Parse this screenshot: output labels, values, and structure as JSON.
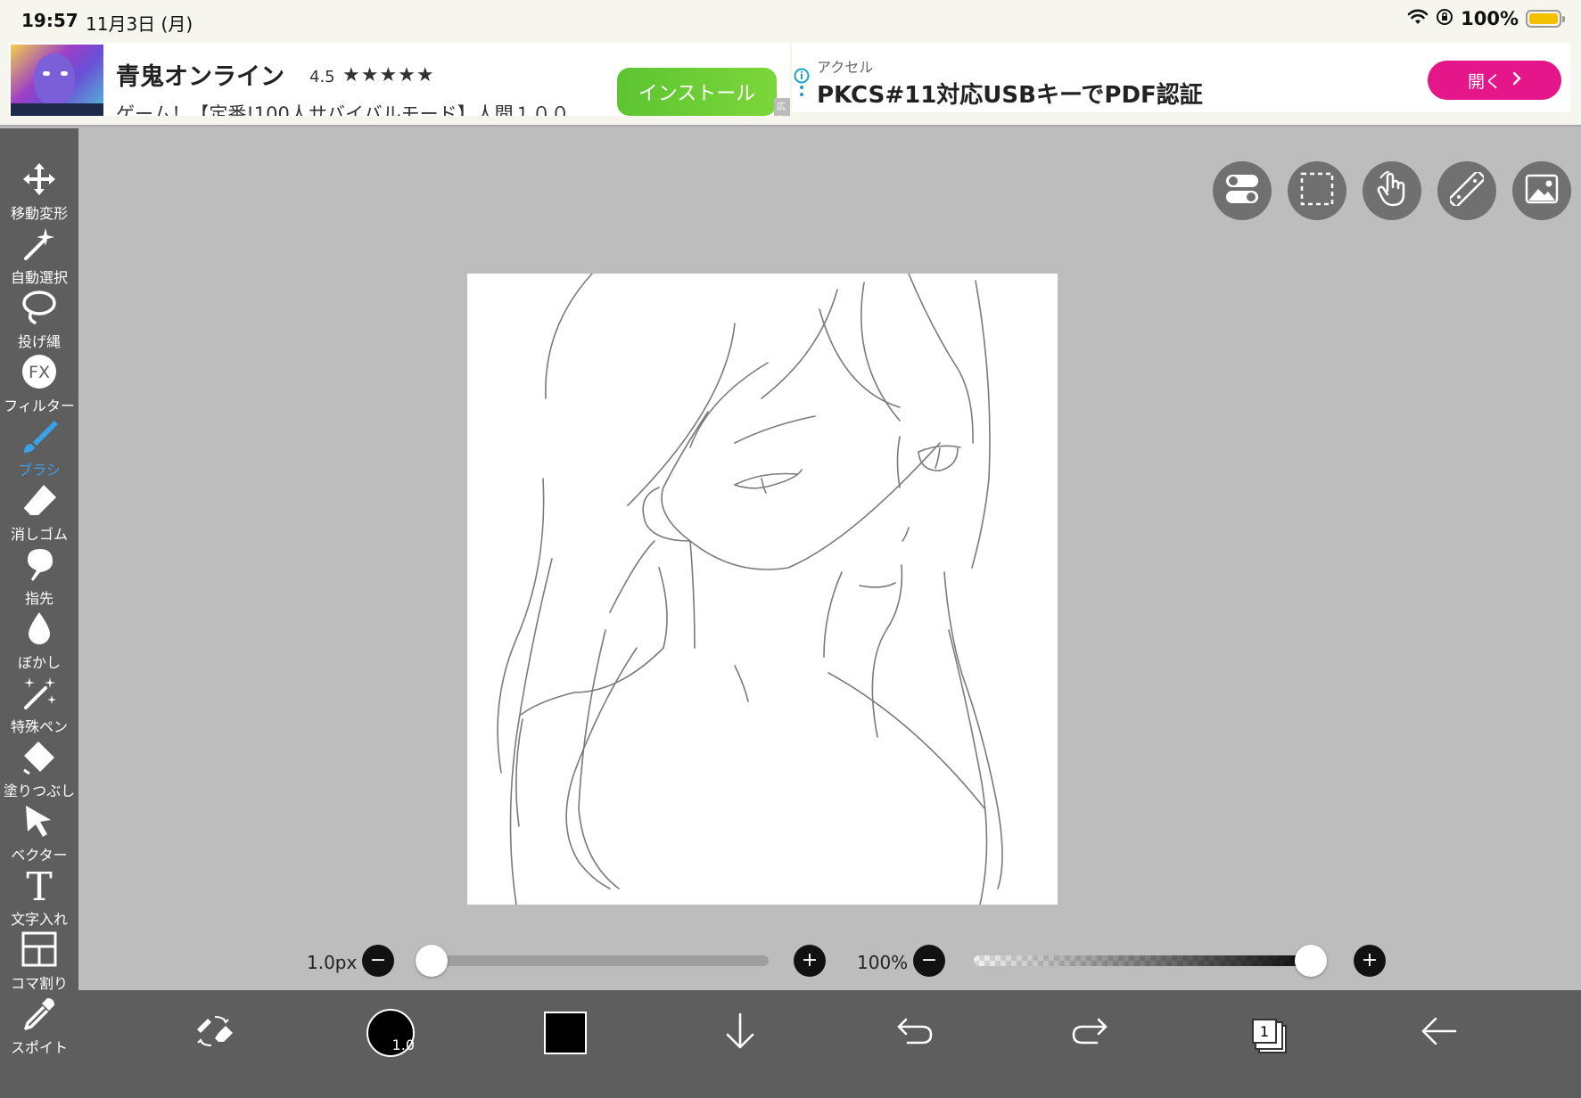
{
  "status_bar": {
    "time": "19:57",
    "date": "11月3日 (月)",
    "battery": "100%"
  },
  "ads": {
    "left": {
      "title": "青鬼オンライン",
      "rating": "4.5",
      "stars": "★★★★★",
      "description": "ゲーム！【定番!100人サバイバルモード】人間１００",
      "button": "インストール",
      "tag": "広告 AD"
    },
    "right": {
      "sponsor": "アクセル",
      "title": "PKCS#11対応USBキーでPDF認証",
      "button": "開く"
    }
  },
  "tools": [
    {
      "label": "移動変形",
      "icon": "move-icon"
    },
    {
      "label": "自動選択",
      "icon": "magic-wand-icon"
    },
    {
      "label": "投げ縄",
      "icon": "lasso-icon"
    },
    {
      "label": "フィルター",
      "icon": "fx-icon",
      "icon_text": "FX"
    },
    {
      "label": "ブラシ",
      "icon": "brush-icon",
      "active": true
    },
    {
      "label": "消しゴム",
      "icon": "eraser-icon"
    },
    {
      "label": "指先",
      "icon": "finger-icon"
    },
    {
      "label": "ぼかし",
      "icon": "blur-icon"
    },
    {
      "label": "特殊ペン",
      "icon": "special-pen-icon"
    },
    {
      "label": "塗りつぶし",
      "icon": "fill-icon"
    },
    {
      "label": "ベクター",
      "icon": "vector-icon"
    },
    {
      "label": "文字入れ",
      "icon": "text-icon",
      "icon_text": "T"
    },
    {
      "label": "コマ割り",
      "icon": "frame-divider-icon"
    },
    {
      "label": "スポイト",
      "icon": "eyedropper-icon"
    }
  ],
  "top_buttons": [
    "toggle-icon",
    "selection-icon",
    "hand-icon",
    "ruler-icon",
    "image-icon"
  ],
  "sliders": {
    "size": {
      "value_label": "1.0px",
      "position": 0.0
    },
    "opacity": {
      "value_label": "100%",
      "position": 1.0
    }
  },
  "bottom_bar": {
    "brush_size_label": "1.0",
    "brush_color": "#000000",
    "layer_count": "1"
  },
  "colors": {
    "active_tool": "#3aa0e8",
    "toolbar_bg": "#5e5e5e",
    "workspace_bg": "#bdbdbd",
    "install_button": "#5dc431",
    "open_button": "#e5158a"
  }
}
